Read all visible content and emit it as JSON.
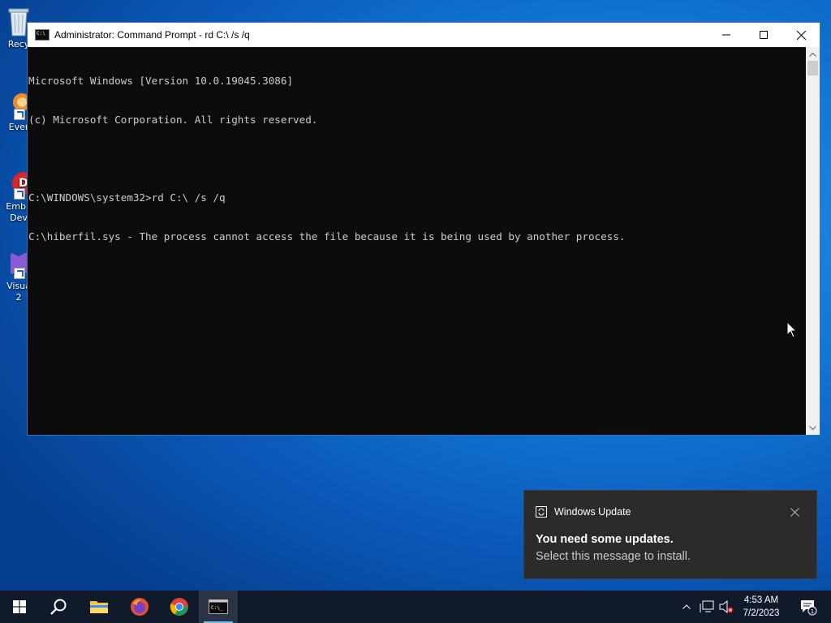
{
  "desktop": {
    "icons": [
      {
        "label": "Recy",
        "name": "recycle-bin-icon"
      },
      {
        "label": "Ever",
        "name": "everything-icon"
      },
      {
        "label": "Emba\nDev",
        "name": "embarcadero-dev-icon"
      },
      {
        "label": "Visua\n2",
        "name": "visual-studio-icon"
      }
    ]
  },
  "window": {
    "title": "Administrator:  Command Prompt - rd  C:\\ /s /q",
    "lines": [
      "Microsoft Windows [Version 10.0.19045.3086]",
      "(c) Microsoft Corporation. All rights reserved.",
      "",
      "C:\\WINDOWS\\system32>rd C:\\ /s /q",
      "C:\\hiberfil.sys - The process cannot access the file because it is being used by another process."
    ]
  },
  "toast": {
    "app": "Windows Update",
    "title": "You need some updates.",
    "body": "Select this message to install."
  },
  "taskbar": {
    "time": "4:53 AM",
    "date": "7/2/2023",
    "notification_count": "1"
  },
  "colors": {
    "console_bg": "#0c0c0c",
    "console_fg": "#cccccc",
    "taskbar_bg": "#101a2a",
    "toast_bg": "#2b2b2b"
  }
}
